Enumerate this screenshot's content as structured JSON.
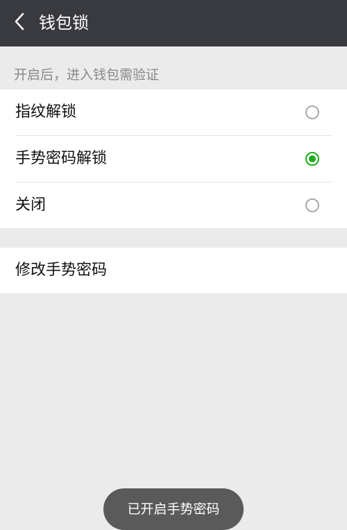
{
  "header": {
    "title": "钱包锁",
    "back_icon": "chevron-left-icon"
  },
  "lock_section": {
    "hint": "开启后，进入钱包需验证",
    "options": [
      {
        "label": "指纹解锁",
        "selected": false
      },
      {
        "label": "手势密码解锁",
        "selected": true
      },
      {
        "label": "关闭",
        "selected": false
      }
    ]
  },
  "modify_section": {
    "label": "修改手势密码"
  },
  "toast": {
    "text": "已开启手势密码"
  },
  "colors": {
    "header_bg": "#393a3f",
    "page_bg": "#ebebeb",
    "accent": "#1aad19"
  }
}
